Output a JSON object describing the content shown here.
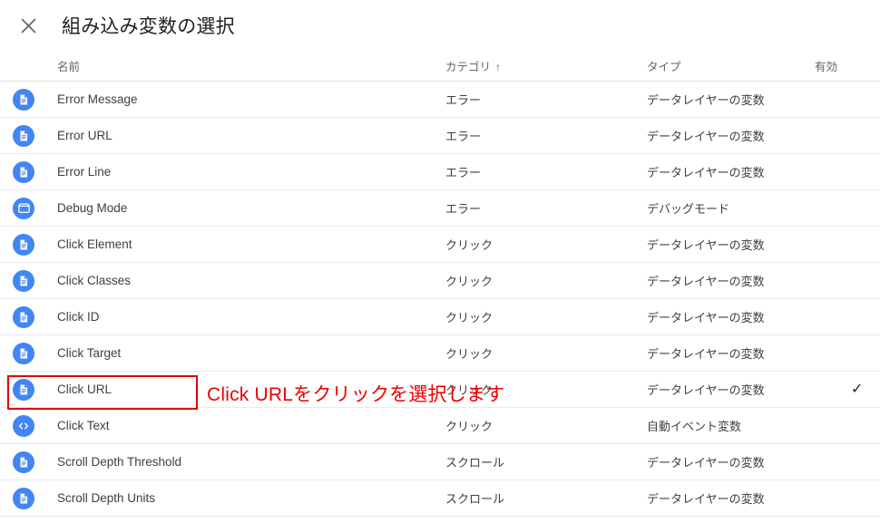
{
  "header": {
    "close_icon": "close-icon",
    "title": "組み込み変数の選択"
  },
  "table": {
    "columns": {
      "name": "名前",
      "category": "カテゴリ",
      "category_sort_arrow": "↑",
      "type": "タイプ",
      "enabled": "有効"
    },
    "rows": [
      {
        "icon": "document-icon",
        "name": "Error Message",
        "category": "エラー",
        "type": "データレイヤーの変数",
        "enabled": ""
      },
      {
        "icon": "document-icon",
        "name": "Error URL",
        "category": "エラー",
        "type": "データレイヤーの変数",
        "enabled": ""
      },
      {
        "icon": "document-icon",
        "name": "Error Line",
        "category": "エラー",
        "type": "データレイヤーの変数",
        "enabled": ""
      },
      {
        "icon": "debug-box-icon",
        "name": "Debug Mode",
        "category": "エラー",
        "type": "デバッグモード",
        "enabled": ""
      },
      {
        "icon": "document-icon",
        "name": "Click Element",
        "category": "クリック",
        "type": "データレイヤーの変数",
        "enabled": ""
      },
      {
        "icon": "document-icon",
        "name": "Click Classes",
        "category": "クリック",
        "type": "データレイヤーの変数",
        "enabled": ""
      },
      {
        "icon": "document-icon",
        "name": "Click ID",
        "category": "クリック",
        "type": "データレイヤーの変数",
        "enabled": ""
      },
      {
        "icon": "document-icon",
        "name": "Click Target",
        "category": "クリック",
        "type": "データレイヤーの変数",
        "enabled": ""
      },
      {
        "icon": "document-icon",
        "name": "Click URL",
        "category": "クリック",
        "type": "データレイヤーの変数",
        "enabled": "✓"
      },
      {
        "icon": "code-icon",
        "name": "Click Text",
        "category": "クリック",
        "type": "自動イベント変数",
        "enabled": ""
      },
      {
        "icon": "document-icon",
        "name": "Scroll Depth Threshold",
        "category": "スクロール",
        "type": "データレイヤーの変数",
        "enabled": ""
      },
      {
        "icon": "document-icon",
        "name": "Scroll Depth Units",
        "category": "スクロール",
        "type": "データレイヤーの変数",
        "enabled": ""
      }
    ]
  },
  "annotation": {
    "text": "Click URLをクリックを選択します",
    "color": "#ee0000"
  },
  "colors": {
    "icon_blue": "#4285f4",
    "divider": "#e8eaed",
    "text_primary": "#3c4043",
    "text_secondary": "#5f6368"
  }
}
